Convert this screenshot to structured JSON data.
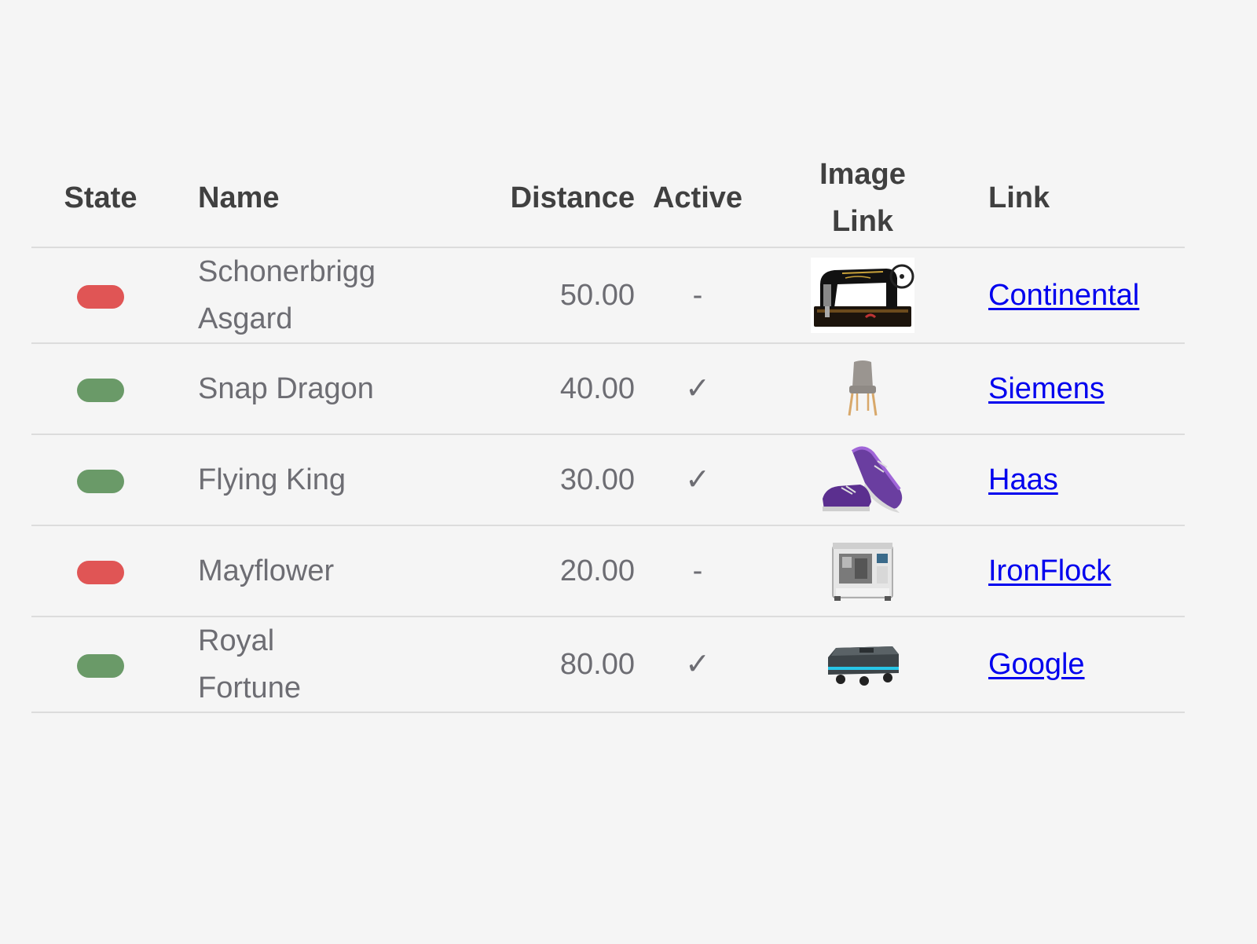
{
  "headers": {
    "state": "State",
    "name": "Name",
    "distance": "Distance",
    "active": "Active",
    "image_link_1": "Image",
    "image_link_2": "Link",
    "link": "Link"
  },
  "rows": [
    {
      "state": "off",
      "state_color": "#e05555",
      "name_1": "Schonerbrigg",
      "name_2": "Asgard",
      "distance": "50.00",
      "active": "-",
      "image": "sewing-machine-image",
      "link": "Continental"
    },
    {
      "state": "on",
      "state_color": "#6a9a68",
      "name_1": "Snap Dragon",
      "name_2": "",
      "distance": "40.00",
      "active": "✓",
      "image": "chair-image",
      "link": "Siemens"
    },
    {
      "state": "on",
      "state_color": "#6a9a68",
      "name_1": "Flying King",
      "name_2": "",
      "distance": "30.00",
      "active": "✓",
      "image": "sneakers-image",
      "link": "Haas"
    },
    {
      "state": "off",
      "state_color": "#e05555",
      "name_1": "Mayflower",
      "name_2": "",
      "distance": "20.00",
      "active": "-",
      "image": "industrial-machine-image",
      "link": "IronFlock"
    },
    {
      "state": "on",
      "state_color": "#6a9a68",
      "name_1": "Royal",
      "name_2": "Fortune",
      "distance": "80.00",
      "active": "✓",
      "image": "mobile-robot-image",
      "link": "Google"
    }
  ]
}
